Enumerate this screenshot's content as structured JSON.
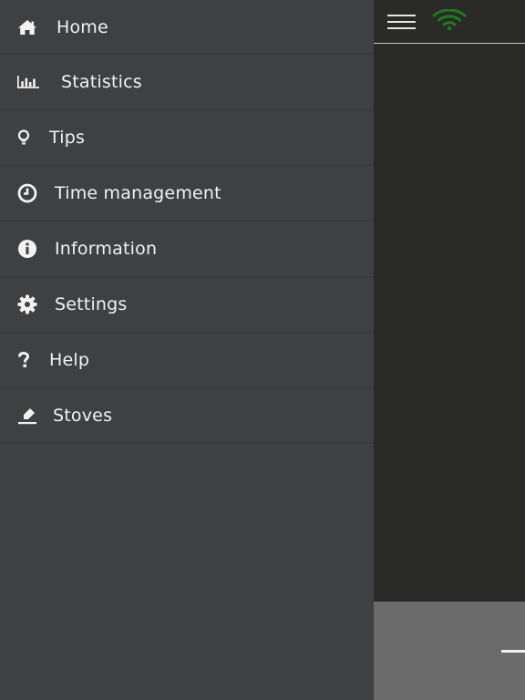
{
  "menu": {
    "items": [
      {
        "label": "Home",
        "icon": "home-icon"
      },
      {
        "label": "Statistics",
        "icon": "bar-chart-icon"
      },
      {
        "label": "Tips",
        "icon": "lightbulb-icon"
      },
      {
        "label": "Time management",
        "icon": "clock-icon"
      },
      {
        "label": "Information",
        "icon": "info-icon"
      },
      {
        "label": "Settings",
        "icon": "gear-icon"
      },
      {
        "label": "Help",
        "icon": "question-icon"
      },
      {
        "label": "Stoves",
        "icon": "stove-icon"
      }
    ]
  },
  "topbar": {
    "menu_icon": "hamburger-icon",
    "status_icon": "wifi-icon",
    "status_color": "#1e7a1e"
  },
  "colors": {
    "drawer_bg": "#3f4042",
    "content_bg": "#2a2a28",
    "footer_bg": "#6b6b6b",
    "text": "#f2f2f2"
  }
}
